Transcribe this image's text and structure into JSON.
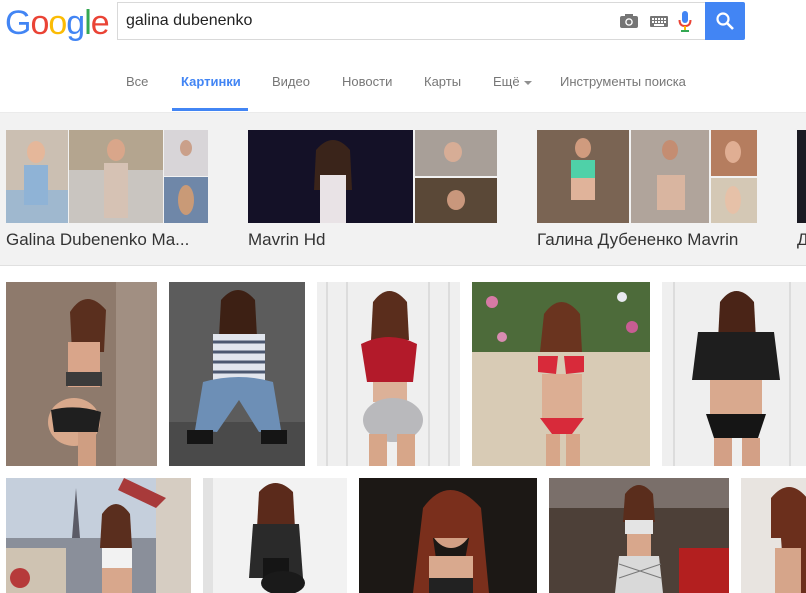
{
  "logo": {
    "letters": [
      "G",
      "o",
      "o",
      "g",
      "l",
      "e"
    ]
  },
  "search": {
    "query": "galina dubenenko"
  },
  "tabs": [
    {
      "label": "Все"
    },
    {
      "label": "Картинки"
    },
    {
      "label": "Видео"
    },
    {
      "label": "Новости"
    },
    {
      "label": "Карты"
    },
    {
      "label": "Ещё"
    },
    {
      "label": "Инструменты поиска"
    }
  ],
  "related": [
    {
      "label": "Galina Dubenenko Ma..."
    },
    {
      "label": "Mavrin Hd"
    },
    {
      "label": "Галина Дубененко Mavrin"
    },
    {
      "label": "Д"
    }
  ],
  "colors": {
    "accent": "#4285f4",
    "logo": [
      "#4285f4",
      "#ea4335",
      "#fbbc05",
      "#4285f4",
      "#34a853",
      "#ea4335"
    ]
  }
}
